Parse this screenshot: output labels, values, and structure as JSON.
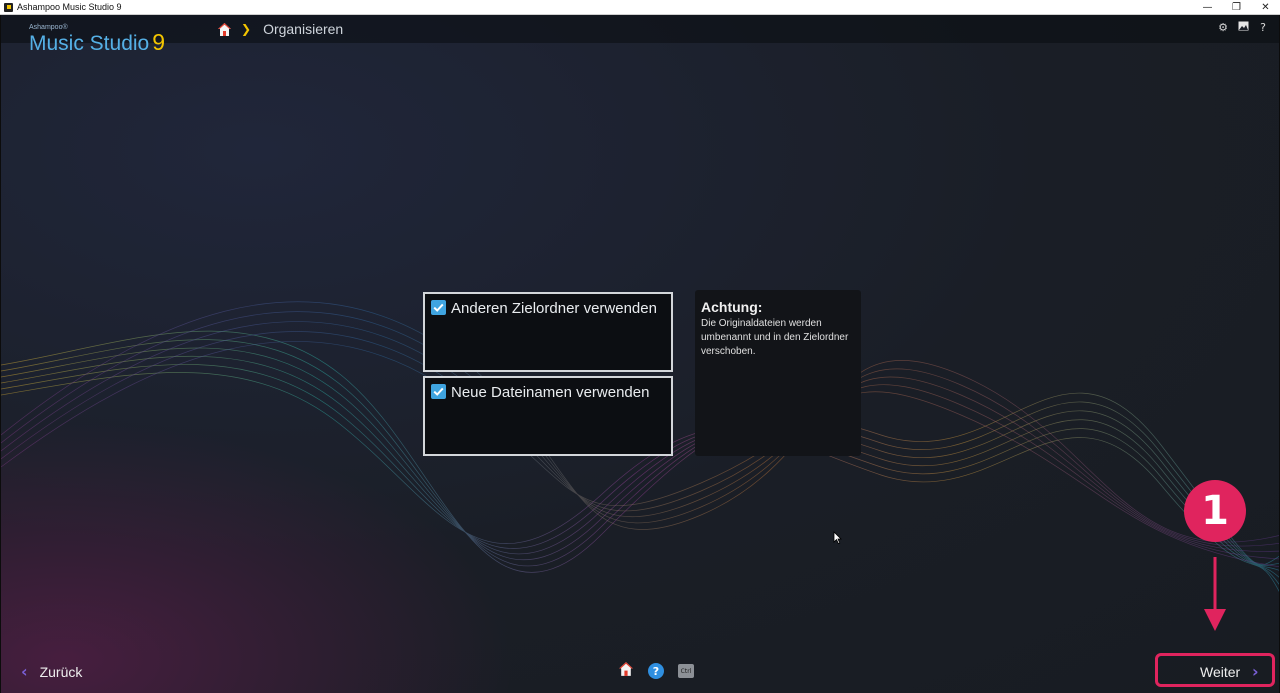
{
  "window": {
    "title": "Ashampoo Music Studio 9",
    "controls": {
      "minimize": "—",
      "restore": "❐",
      "close": "✕"
    }
  },
  "brand": {
    "vendor": "Ashampoo®",
    "name": "Music Studio",
    "version": "9"
  },
  "breadcrumb": {
    "current": "Organisieren"
  },
  "header_tools": [
    "gear-icon",
    "image-icon",
    "help-icon"
  ],
  "options": [
    {
      "label": "Anderen Zielordner verwenden",
      "checked": true
    },
    {
      "label": "Neue Dateinamen verwenden",
      "checked": true
    }
  ],
  "info": {
    "title": "Achtung:",
    "text": "Die Originaldateien werden umbenannt und in den Zielordner verschoben."
  },
  "footer": {
    "back_label": "Zurück",
    "next_label": "Weiter",
    "ctrl_label": "Ctrl",
    "help_label": "?"
  },
  "annotation": {
    "step": "1"
  },
  "colors": {
    "accent_blue": "#3fa4e0",
    "accent_yellow": "#f3c500",
    "annotation_red": "#e0245e",
    "nav_purple": "#7a5fd6"
  }
}
